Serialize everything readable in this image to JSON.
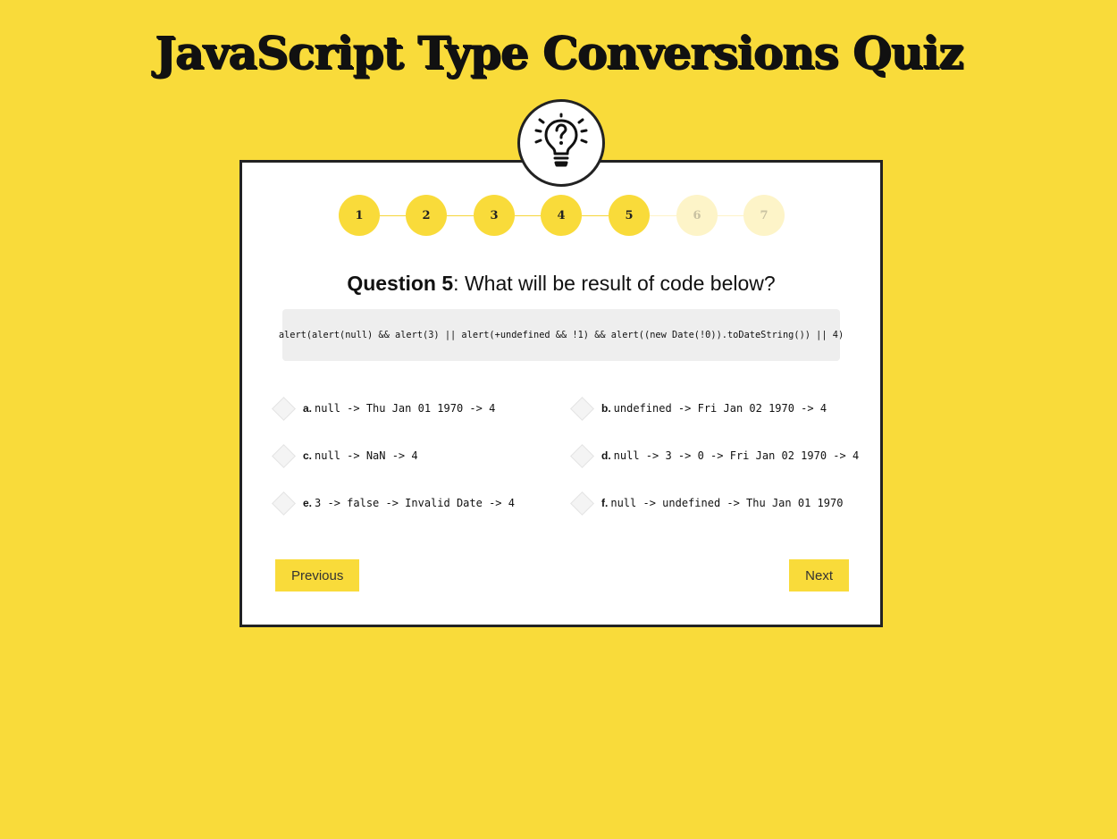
{
  "header": {
    "title": "JavaScript Type Conversions Quiz",
    "badge_icon": "lightbulb-question-icon"
  },
  "progress": {
    "steps": [
      "1",
      "2",
      "3",
      "4",
      "5",
      "6",
      "7"
    ],
    "current_step": 5,
    "completed_color": "#f9db3a",
    "pending_color": "#fdf4c8"
  },
  "question": {
    "label": "Question 5",
    "text": ": What will be result of code below?",
    "code": "alert(alert(null) && alert(3) || alert(+undefined && !1) && alert((new Date(!0)).toDateString()) || 4)"
  },
  "options": [
    {
      "letter": "a.",
      "text": "null -> Thu Jan 01 1970 -> 4"
    },
    {
      "letter": "b.",
      "text": "undefined -> Fri Jan 02 1970 -> 4"
    },
    {
      "letter": "c.",
      "text": "null -> NaN -> 4"
    },
    {
      "letter": "d.",
      "text": "null -> 3 -> 0 -> Fri Jan 02 1970 -> 4"
    },
    {
      "letter": "e.",
      "text": "3 -> false -> Invalid Date -> 4"
    },
    {
      "letter": "f.",
      "text": "null -> undefined -> Thu Jan 01 1970"
    }
  ],
  "navigation": {
    "previous_label": "Previous",
    "next_label": "Next"
  },
  "colors": {
    "background": "#f9db3a",
    "card": "#ffffff",
    "border": "#222222",
    "code_background": "#eeeeee"
  }
}
